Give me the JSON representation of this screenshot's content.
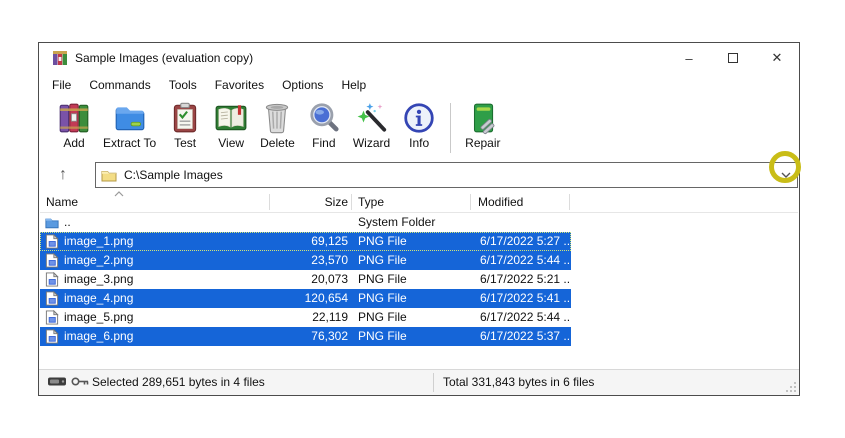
{
  "window": {
    "title": "Sample Images (evaluation copy)",
    "app_icon": "winrar-logo-icon",
    "controls": {
      "minimize_glyph": "–",
      "close_glyph": "✕"
    }
  },
  "menu": {
    "items": [
      {
        "label": "File"
      },
      {
        "label": "Commands"
      },
      {
        "label": "Tools"
      },
      {
        "label": "Favorites"
      },
      {
        "label": "Options"
      },
      {
        "label": "Help"
      }
    ]
  },
  "toolbar": {
    "buttons": [
      {
        "label": "Add",
        "icon": "add-archive-icon"
      },
      {
        "label": "Extract To",
        "icon": "extract-to-folder-icon"
      },
      {
        "label": "Test",
        "icon": "test-checklist-icon"
      },
      {
        "label": "View",
        "icon": "view-book-icon"
      },
      {
        "label": "Delete",
        "icon": "delete-trash-icon"
      },
      {
        "label": "Find",
        "icon": "find-magnifier-icon"
      },
      {
        "label": "Wizard",
        "icon": "wizard-wand-icon"
      },
      {
        "label": "Info",
        "icon": "info-circle-icon"
      },
      {
        "label": "Repair",
        "icon": "repair-wrench-icon"
      }
    ]
  },
  "addressbar": {
    "path": "C:\\Sample Images",
    "up_icon": "up-arrow-icon",
    "folder_icon": "folder-icon",
    "dropdown_icon": "chevron-down-icon"
  },
  "list": {
    "columns": [
      {
        "label": "Name"
      },
      {
        "label": "Size"
      },
      {
        "label": "Type"
      },
      {
        "label": "Modified"
      }
    ],
    "sort": {
      "column": "Name",
      "ascending": true
    },
    "rows": [
      {
        "name": "..",
        "size": "",
        "type": "System Folder",
        "modified": "",
        "selected": false,
        "icon": "folder-up-icon"
      },
      {
        "name": "image_1.png",
        "size": "69,125",
        "type": "PNG File",
        "modified": "6/17/2022 5:27 ...",
        "selected": true,
        "icon": "image-file-icon"
      },
      {
        "name": "image_2.png",
        "size": "23,570",
        "type": "PNG File",
        "modified": "6/17/2022 5:44 ...",
        "selected": true,
        "icon": "image-file-icon"
      },
      {
        "name": "image_3.png",
        "size": "20,073",
        "type": "PNG File",
        "modified": "6/17/2022 5:21 ...",
        "selected": false,
        "icon": "image-file-icon"
      },
      {
        "name": "image_4.png",
        "size": "120,654",
        "type": "PNG File",
        "modified": "6/17/2022 5:41 ...",
        "selected": true,
        "icon": "image-file-icon"
      },
      {
        "name": "image_5.png",
        "size": "22,119",
        "type": "PNG File",
        "modified": "6/17/2022 5:44 ...",
        "selected": false,
        "icon": "image-file-icon"
      },
      {
        "name": "image_6.png",
        "size": "76,302",
        "type": "PNG File",
        "modified": "6/17/2022 5:37 ...",
        "selected": true,
        "icon": "image-file-icon"
      }
    ]
  },
  "statusbar": {
    "selected_text": "Selected 289,651 bytes in 4 files",
    "total_text": "Total 331,843 bytes in 6 files",
    "icons": [
      "disk-icon",
      "key-icon"
    ]
  },
  "annotation": {
    "type": "highlight-circle",
    "target": "address-dropdown-button",
    "color": "#c9bd17"
  },
  "colors": {
    "selection_blue": "#1565d8",
    "window_border": "#4c4c4c"
  }
}
